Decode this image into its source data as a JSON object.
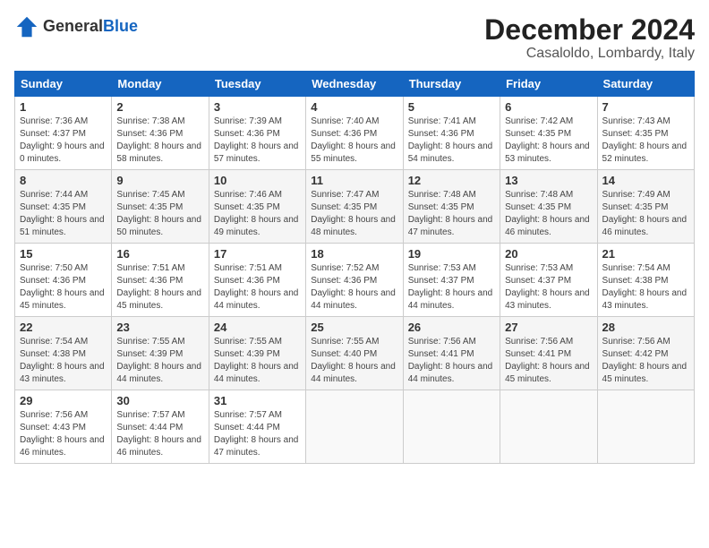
{
  "logo": {
    "general": "General",
    "blue": "Blue"
  },
  "header": {
    "month": "December 2024",
    "location": "Casaloldo, Lombardy, Italy"
  },
  "weekdays": [
    "Sunday",
    "Monday",
    "Tuesday",
    "Wednesday",
    "Thursday",
    "Friday",
    "Saturday"
  ],
  "weeks": [
    [
      {
        "day": "1",
        "sunrise": "Sunrise: 7:36 AM",
        "sunset": "Sunset: 4:37 PM",
        "daylight": "Daylight: 9 hours and 0 minutes."
      },
      {
        "day": "2",
        "sunrise": "Sunrise: 7:38 AM",
        "sunset": "Sunset: 4:36 PM",
        "daylight": "Daylight: 8 hours and 58 minutes."
      },
      {
        "day": "3",
        "sunrise": "Sunrise: 7:39 AM",
        "sunset": "Sunset: 4:36 PM",
        "daylight": "Daylight: 8 hours and 57 minutes."
      },
      {
        "day": "4",
        "sunrise": "Sunrise: 7:40 AM",
        "sunset": "Sunset: 4:36 PM",
        "daylight": "Daylight: 8 hours and 55 minutes."
      },
      {
        "day": "5",
        "sunrise": "Sunrise: 7:41 AM",
        "sunset": "Sunset: 4:36 PM",
        "daylight": "Daylight: 8 hours and 54 minutes."
      },
      {
        "day": "6",
        "sunrise": "Sunrise: 7:42 AM",
        "sunset": "Sunset: 4:35 PM",
        "daylight": "Daylight: 8 hours and 53 minutes."
      },
      {
        "day": "7",
        "sunrise": "Sunrise: 7:43 AM",
        "sunset": "Sunset: 4:35 PM",
        "daylight": "Daylight: 8 hours and 52 minutes."
      }
    ],
    [
      {
        "day": "8",
        "sunrise": "Sunrise: 7:44 AM",
        "sunset": "Sunset: 4:35 PM",
        "daylight": "Daylight: 8 hours and 51 minutes."
      },
      {
        "day": "9",
        "sunrise": "Sunrise: 7:45 AM",
        "sunset": "Sunset: 4:35 PM",
        "daylight": "Daylight: 8 hours and 50 minutes."
      },
      {
        "day": "10",
        "sunrise": "Sunrise: 7:46 AM",
        "sunset": "Sunset: 4:35 PM",
        "daylight": "Daylight: 8 hours and 49 minutes."
      },
      {
        "day": "11",
        "sunrise": "Sunrise: 7:47 AM",
        "sunset": "Sunset: 4:35 PM",
        "daylight": "Daylight: 8 hours and 48 minutes."
      },
      {
        "day": "12",
        "sunrise": "Sunrise: 7:48 AM",
        "sunset": "Sunset: 4:35 PM",
        "daylight": "Daylight: 8 hours and 47 minutes."
      },
      {
        "day": "13",
        "sunrise": "Sunrise: 7:48 AM",
        "sunset": "Sunset: 4:35 PM",
        "daylight": "Daylight: 8 hours and 46 minutes."
      },
      {
        "day": "14",
        "sunrise": "Sunrise: 7:49 AM",
        "sunset": "Sunset: 4:35 PM",
        "daylight": "Daylight: 8 hours and 46 minutes."
      }
    ],
    [
      {
        "day": "15",
        "sunrise": "Sunrise: 7:50 AM",
        "sunset": "Sunset: 4:36 PM",
        "daylight": "Daylight: 8 hours and 45 minutes."
      },
      {
        "day": "16",
        "sunrise": "Sunrise: 7:51 AM",
        "sunset": "Sunset: 4:36 PM",
        "daylight": "Daylight: 8 hours and 45 minutes."
      },
      {
        "day": "17",
        "sunrise": "Sunrise: 7:51 AM",
        "sunset": "Sunset: 4:36 PM",
        "daylight": "Daylight: 8 hours and 44 minutes."
      },
      {
        "day": "18",
        "sunrise": "Sunrise: 7:52 AM",
        "sunset": "Sunset: 4:36 PM",
        "daylight": "Daylight: 8 hours and 44 minutes."
      },
      {
        "day": "19",
        "sunrise": "Sunrise: 7:53 AM",
        "sunset": "Sunset: 4:37 PM",
        "daylight": "Daylight: 8 hours and 44 minutes."
      },
      {
        "day": "20",
        "sunrise": "Sunrise: 7:53 AM",
        "sunset": "Sunset: 4:37 PM",
        "daylight": "Daylight: 8 hours and 43 minutes."
      },
      {
        "day": "21",
        "sunrise": "Sunrise: 7:54 AM",
        "sunset": "Sunset: 4:38 PM",
        "daylight": "Daylight: 8 hours and 43 minutes."
      }
    ],
    [
      {
        "day": "22",
        "sunrise": "Sunrise: 7:54 AM",
        "sunset": "Sunset: 4:38 PM",
        "daylight": "Daylight: 8 hours and 43 minutes."
      },
      {
        "day": "23",
        "sunrise": "Sunrise: 7:55 AM",
        "sunset": "Sunset: 4:39 PM",
        "daylight": "Daylight: 8 hours and 44 minutes."
      },
      {
        "day": "24",
        "sunrise": "Sunrise: 7:55 AM",
        "sunset": "Sunset: 4:39 PM",
        "daylight": "Daylight: 8 hours and 44 minutes."
      },
      {
        "day": "25",
        "sunrise": "Sunrise: 7:55 AM",
        "sunset": "Sunset: 4:40 PM",
        "daylight": "Daylight: 8 hours and 44 minutes."
      },
      {
        "day": "26",
        "sunrise": "Sunrise: 7:56 AM",
        "sunset": "Sunset: 4:41 PM",
        "daylight": "Daylight: 8 hours and 44 minutes."
      },
      {
        "day": "27",
        "sunrise": "Sunrise: 7:56 AM",
        "sunset": "Sunset: 4:41 PM",
        "daylight": "Daylight: 8 hours and 45 minutes."
      },
      {
        "day": "28",
        "sunrise": "Sunrise: 7:56 AM",
        "sunset": "Sunset: 4:42 PM",
        "daylight": "Daylight: 8 hours and 45 minutes."
      }
    ],
    [
      {
        "day": "29",
        "sunrise": "Sunrise: 7:56 AM",
        "sunset": "Sunset: 4:43 PM",
        "daylight": "Daylight: 8 hours and 46 minutes."
      },
      {
        "day": "30",
        "sunrise": "Sunrise: 7:57 AM",
        "sunset": "Sunset: 4:44 PM",
        "daylight": "Daylight: 8 hours and 46 minutes."
      },
      {
        "day": "31",
        "sunrise": "Sunrise: 7:57 AM",
        "sunset": "Sunset: 4:44 PM",
        "daylight": "Daylight: 8 hours and 47 minutes."
      },
      null,
      null,
      null,
      null
    ]
  ]
}
